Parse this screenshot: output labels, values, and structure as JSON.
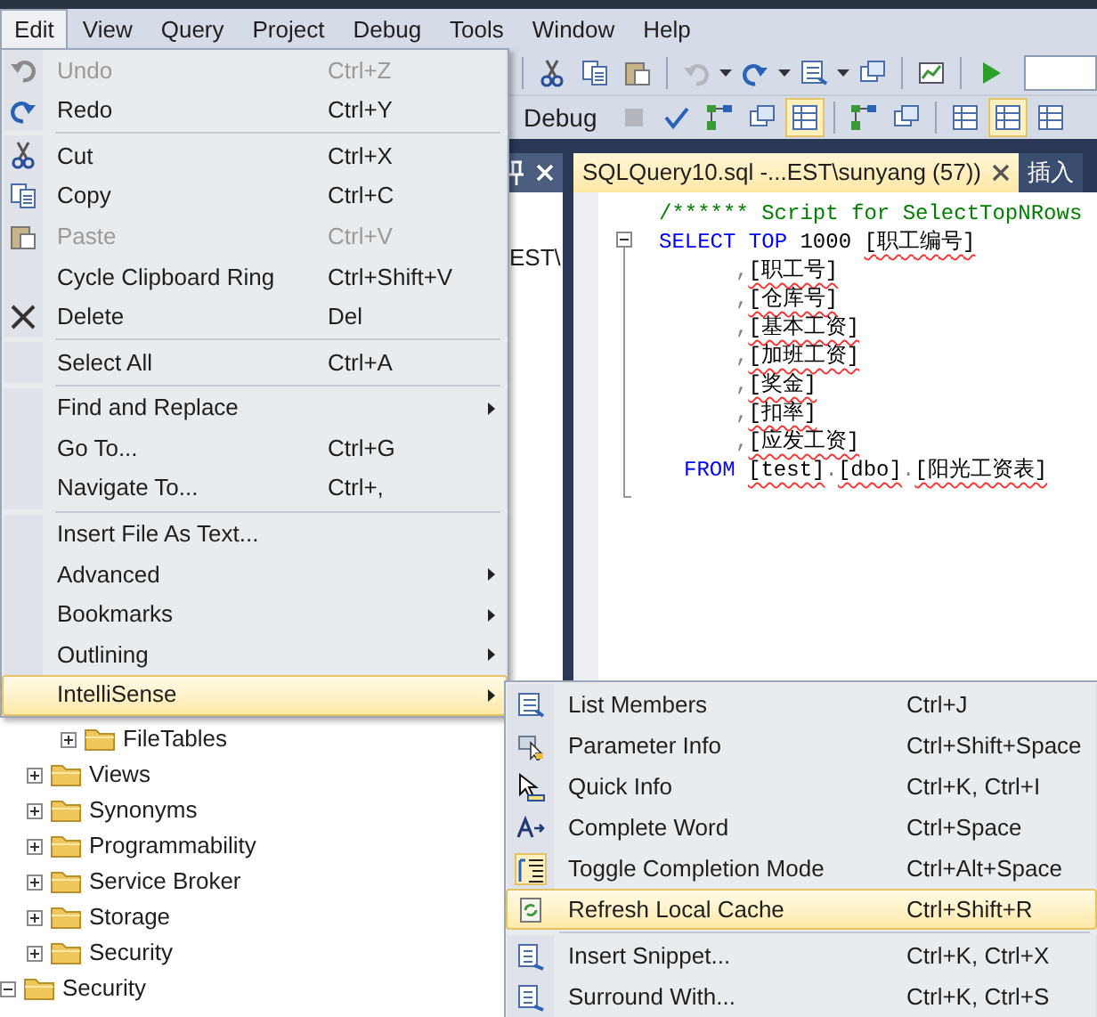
{
  "menu_bar": [
    {
      "label": "Edit",
      "selected": true
    },
    {
      "label": "View",
      "selected": false
    },
    {
      "label": "Query",
      "selected": false
    },
    {
      "label": "Project",
      "selected": false
    },
    {
      "label": "Debug",
      "selected": false
    },
    {
      "label": "Tools",
      "selected": false
    },
    {
      "label": "Window",
      "selected": false
    },
    {
      "label": "Help",
      "selected": false
    }
  ],
  "toolbars": [
    {
      "items": [
        {
          "kind": "separator"
        },
        {
          "kind": "button",
          "checked": false,
          "disabled": false
        },
        {
          "kind": "button",
          "checked": false,
          "disabled": false
        },
        {
          "kind": "button",
          "checked": false,
          "disabled": false
        },
        {
          "kind": "separator"
        },
        {
          "kind": "button",
          "checked": false,
          "disabled": true
        },
        {
          "kind": "dropdown"
        },
        {
          "kind": "button",
          "checked": false,
          "disabled": false
        },
        {
          "kind": "dropdown"
        },
        {
          "kind": "button",
          "checked": false,
          "disabled": false
        },
        {
          "kind": "dropdown"
        },
        {
          "kind": "button",
          "checked": false,
          "disabled": false
        },
        {
          "kind": "separator"
        },
        {
          "kind": "button",
          "checked": false,
          "disabled": false
        },
        {
          "kind": "separator"
        },
        {
          "kind": "button",
          "checked": false,
          "disabled": false
        },
        {
          "kind": "field"
        }
      ]
    },
    {
      "items": [
        {
          "kind": "label",
          "text": "Debug"
        },
        {
          "kind": "button",
          "checked": false,
          "disabled": true
        },
        {
          "kind": "button",
          "checked": false,
          "disabled": false
        },
        {
          "kind": "button",
          "checked": false,
          "disabled": false
        },
        {
          "kind": "button",
          "checked": false,
          "disabled": false
        },
        {
          "kind": "button",
          "checked": true,
          "disabled": false
        },
        {
          "kind": "separator"
        },
        {
          "kind": "button",
          "checked": false,
          "disabled": false
        },
        {
          "kind": "button",
          "checked": false,
          "disabled": false
        },
        {
          "kind": "separator"
        },
        {
          "kind": "button",
          "checked": false,
          "disabled": false
        },
        {
          "kind": "button",
          "checked": true,
          "disabled": false
        },
        {
          "kind": "button",
          "checked": false,
          "disabled": false
        }
      ]
    }
  ],
  "object_explorer": {
    "connection_text": "EST\\",
    "tree": [
      {
        "children": [
          {
            "children": [
              {
                "label": "FileTables",
                "expanded": false
              }
            ]
          },
          {
            "label": "Views",
            "expanded": false
          },
          {
            "label": "Synonyms",
            "expanded": false
          },
          {
            "label": "Programmability",
            "expanded": false
          },
          {
            "label": "Service Broker",
            "expanded": false
          },
          {
            "label": "Storage",
            "expanded": false
          },
          {
            "label": "Security",
            "expanded": false
          }
        ]
      },
      {
        "label": "Security",
        "expanded": true
      }
    ]
  },
  "editor": {
    "tabs": [
      {
        "label": "SQLQuery10.sql -...EST\\sunyang (57))",
        "selected": true
      },
      {
        "label": "插入",
        "selected": false
      }
    ],
    "lines": [
      {
        "kind": "comment",
        "tokens": [
          {
            "kind": "comment",
            "text": "/****** Script for SelectTopNRows"
          }
        ]
      },
      {
        "kind": "select",
        "tokens": [
          {
            "kind": "keyword",
            "text": "SELECT"
          },
          {
            "kind": "keyword",
            "text": "TOP"
          },
          {
            "kind": "plain",
            "text": "1000"
          },
          {
            "kind": "ident",
            "text": "[职工编号]"
          }
        ]
      },
      {
        "kind": "column",
        "tokens": [
          {
            "kind": "punct",
            "text": ","
          },
          {
            "kind": "ident",
            "text": "[职工号]"
          }
        ]
      },
      {
        "kind": "column",
        "tokens": [
          {
            "kind": "punct",
            "text": ","
          },
          {
            "kind": "ident",
            "text": "[仓库号]"
          }
        ]
      },
      {
        "kind": "column",
        "tokens": [
          {
            "kind": "punct",
            "text": ","
          },
          {
            "kind": "ident",
            "text": "[基本工资]"
          }
        ]
      },
      {
        "kind": "column",
        "tokens": [
          {
            "kind": "punct",
            "text": ","
          },
          {
            "kind": "ident",
            "text": "[加班工资]"
          }
        ]
      },
      {
        "kind": "column",
        "tokens": [
          {
            "kind": "punct",
            "text": ","
          },
          {
            "kind": "ident",
            "text": "[奖金]"
          }
        ]
      },
      {
        "kind": "column",
        "tokens": [
          {
            "kind": "punct",
            "text": ","
          },
          {
            "kind": "ident",
            "text": "[扣率]"
          }
        ]
      },
      {
        "kind": "column",
        "tokens": [
          {
            "kind": "punct",
            "text": ","
          },
          {
            "kind": "ident",
            "text": "[应发工资]"
          }
        ]
      },
      {
        "kind": "from",
        "tokens": [
          {
            "kind": "keyword",
            "text": "FROM"
          },
          {
            "kind": "ident",
            "text": "[test]"
          },
          {
            "kind": "punct",
            "text": "."
          },
          {
            "kind": "ident",
            "text": "[dbo]"
          },
          {
            "kind": "punct",
            "text": "."
          },
          {
            "kind": "ident",
            "text": "[阳光工资表]"
          }
        ]
      }
    ]
  },
  "edit_menu": {
    "items": [
      {
        "kind": "item",
        "label": "Undo",
        "shortcut": "Ctrl+Z",
        "disabled": true,
        "submenu": false,
        "selected": false
      },
      {
        "kind": "item",
        "label": "Redo",
        "shortcut": "Ctrl+Y",
        "disabled": false,
        "submenu": false,
        "selected": false
      },
      {
        "kind": "separator"
      },
      {
        "kind": "item",
        "label": "Cut",
        "shortcut": "Ctrl+X",
        "disabled": false,
        "submenu": false,
        "selected": false
      },
      {
        "kind": "item",
        "label": "Copy",
        "shortcut": "Ctrl+C",
        "disabled": false,
        "submenu": false,
        "selected": false
      },
      {
        "kind": "item",
        "label": "Paste",
        "shortcut": "Ctrl+V",
        "disabled": true,
        "submenu": false,
        "selected": false
      },
      {
        "kind": "item",
        "label": "Cycle Clipboard Ring",
        "shortcut": "Ctrl+Shift+V",
        "disabled": false,
        "submenu": false,
        "selected": false
      },
      {
        "kind": "item",
        "label": "Delete",
        "shortcut": "Del",
        "disabled": false,
        "submenu": false,
        "selected": false
      },
      {
        "kind": "separator"
      },
      {
        "kind": "item",
        "label": "Select All",
        "shortcut": "Ctrl+A",
        "disabled": false,
        "submenu": false,
        "selected": false
      },
      {
        "kind": "separator"
      },
      {
        "kind": "item",
        "label": "Find and Replace",
        "disabled": false,
        "submenu": true,
        "selected": false
      },
      {
        "kind": "item",
        "label": "Go To...",
        "shortcut": "Ctrl+G",
        "disabled": false,
        "submenu": false,
        "selected": false
      },
      {
        "kind": "item",
        "label": "Navigate To...",
        "shortcut": "Ctrl+,",
        "disabled": false,
        "submenu": false,
        "selected": false
      },
      {
        "kind": "separator"
      },
      {
        "kind": "item",
        "label": "Insert File As Text...",
        "disabled": false,
        "submenu": false,
        "selected": false
      },
      {
        "kind": "item",
        "label": "Advanced",
        "disabled": false,
        "submenu": true,
        "selected": false
      },
      {
        "kind": "item",
        "label": "Bookmarks",
        "disabled": false,
        "submenu": true,
        "selected": false
      },
      {
        "kind": "item",
        "label": "Outlining",
        "disabled": false,
        "submenu": true,
        "selected": false
      },
      {
        "kind": "item",
        "label": "IntelliSense",
        "disabled": false,
        "submenu": true,
        "selected": true
      }
    ]
  },
  "intellisense_menu": {
    "items": [
      {
        "kind": "item",
        "label": "List Members",
        "shortcut": "Ctrl+J",
        "checked": false,
        "selected": false
      },
      {
        "kind": "item",
        "label": "Parameter Info",
        "shortcut": "Ctrl+Shift+Space",
        "checked": false,
        "selected": false
      },
      {
        "kind": "item",
        "label": "Quick Info",
        "shortcut": "Ctrl+K, Ctrl+I",
        "checked": false,
        "selected": false
      },
      {
        "kind": "item",
        "label": "Complete Word",
        "shortcut": "Ctrl+Space",
        "checked": false,
        "selected": false
      },
      {
        "kind": "item",
        "label": "Toggle Completion Mode",
        "shortcut": "Ctrl+Alt+Space",
        "checked": true,
        "selected": false
      },
      {
        "kind": "item",
        "label": "Refresh Local Cache",
        "shortcut": "Ctrl+Shift+R",
        "checked": false,
        "selected": true
      },
      {
        "kind": "separator"
      },
      {
        "kind": "item",
        "label": "Insert Snippet...",
        "shortcut": "Ctrl+K, Ctrl+X",
        "checked": false,
        "selected": false
      },
      {
        "kind": "item",
        "label": "Surround With...",
        "shortcut": "Ctrl+K, Ctrl+S",
        "checked": false,
        "selected": false
      }
    ]
  }
}
